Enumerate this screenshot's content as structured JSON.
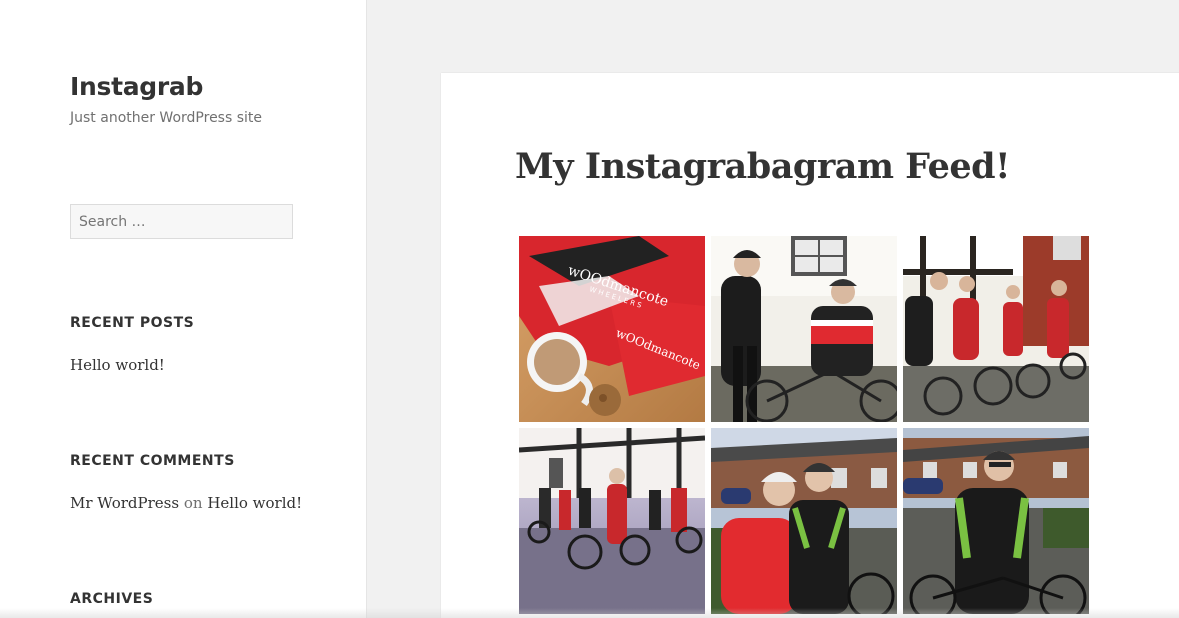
{
  "site": {
    "title": "Instagrab",
    "description": "Just another WordPress site"
  },
  "search": {
    "placeholder": "Search …"
  },
  "widgets": {
    "recent_posts": {
      "title": "RECENT POSTS",
      "items": [
        "Hello world!"
      ]
    },
    "recent_comments": {
      "title": "RECENT COMMENTS",
      "author": "Mr WordPress",
      "connector": "on",
      "post": "Hello world!"
    },
    "archives": {
      "title": "ARCHIVES"
    }
  },
  "page": {
    "title": "My Instagrabagram Feed!"
  },
  "gallery": {
    "photos": [
      {
        "subject": "woodmancote-wheelers-jersey-tea"
      },
      {
        "subject": "two-cyclists-white-house"
      },
      {
        "subject": "cyclists-tudor-building"
      },
      {
        "subject": "cycling-group-tudor-street"
      },
      {
        "subject": "two-cyclists-red-green"
      },
      {
        "subject": "cyclist-green-jacket"
      }
    ]
  }
}
